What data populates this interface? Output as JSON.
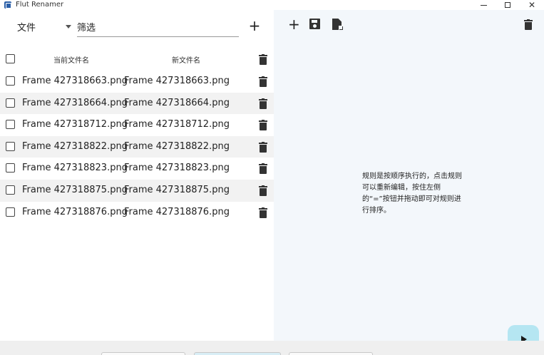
{
  "app": {
    "title": "Flut Renamer"
  },
  "window_controls": {
    "minimize_icon": "minimize-icon",
    "maximize_icon": "maximize-icon",
    "close_glyph": "✕"
  },
  "left_panel": {
    "filter_dropdown": {
      "selected": "文件"
    },
    "filter_input": {
      "value": "筛选"
    },
    "add_glyph": "+",
    "headers": {
      "current_name": "当前文件名",
      "new_name": "新文件名"
    },
    "rows": [
      {
        "current": "Frame 427318663.png",
        "new": "Frame 427318663.png"
      },
      {
        "current": "Frame 427318664.png",
        "new": "Frame 427318664.png"
      },
      {
        "current": "Frame 427318712.png",
        "new": "Frame 427318712.png"
      },
      {
        "current": "Frame 427318822.png",
        "new": "Frame 427318822.png"
      },
      {
        "current": "Frame 427318823.png",
        "new": "Frame 427318823.png"
      },
      {
        "current": "Frame 427318875.png",
        "new": "Frame 427318875.png"
      },
      {
        "current": "Frame 427318876.png",
        "new": "Frame 427318876.png"
      }
    ]
  },
  "right_panel": {
    "toolbar": {
      "add_glyph": "+",
      "icons": [
        "plus-icon",
        "save-icon",
        "import-file-icon",
        "trash-icon"
      ]
    },
    "hint": "规则是按顺序执行的，点击规则可以重新编辑，按住左侧的“=”按钮并拖动即可对规则进行排序。",
    "run_icon": "play-icon"
  },
  "colors": {
    "right_panel_bg": "#f3f7fb",
    "row_alt_bg": "#f2f2f2",
    "run_button_bg": "#b5e6f2"
  }
}
